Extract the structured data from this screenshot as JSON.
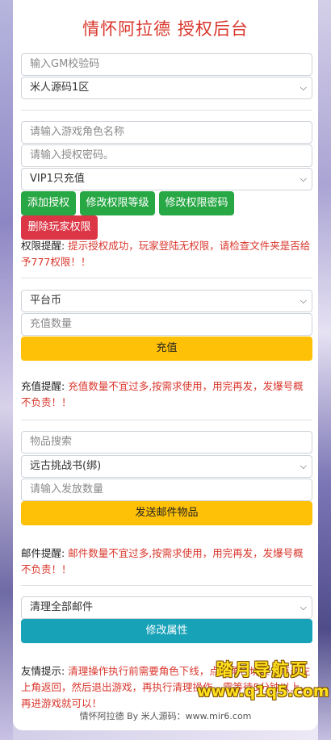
{
  "title": "情怀阿拉德 授权后台",
  "gm": {
    "code_placeholder": "输入GM校验码",
    "server_selected": "米人源码1区"
  },
  "auth": {
    "role_placeholder": "请输入游戏角色名称",
    "password_placeholder": "请输入授权密码。",
    "level_selected": "VIP1只充值",
    "add_label": "添加授权",
    "modify_level_label": "修改权限等级",
    "modify_password_label": "修改权限密码",
    "delete_label": "删除玩家权限",
    "notice_prefix": "权限提醒:",
    "notice_text": "提示授权成功，玩家登陆无权限，请检查文件夹是否给予777权限！！"
  },
  "recharge": {
    "currency_selected": "平台币",
    "amount_placeholder": "充值数量",
    "button_label": "充值",
    "notice_prefix": "充值提醒:",
    "notice_text": "充值数量不宜过多,按需求使用，用完再发，发爆号概不负责！！"
  },
  "mail": {
    "search_placeholder": "物品搜索",
    "item_selected": "远古挑战书(绑)",
    "quantity_placeholder": "请输入发放数量",
    "button_label": "发送邮件物品",
    "notice_prefix": "邮件提醒:",
    "notice_text": "邮件数量不宜过多,按需求使用，用完再发，发爆号概不负责！！"
  },
  "cleanup": {
    "action_selected": "清理全部邮件",
    "button_label": "修改属性",
    "notice_prefix": "友情提示:",
    "notice_text": "清理操作执行前需要角色下线，点击角色切换，点击左上角返回，然后退出游戏，再执行清理操作，需等待5分钟以上，再进游戏就可以！"
  },
  "footer": "情怀阿拉德 By 米人源码：www.mir6.com",
  "watermark": {
    "line1": "踏月导航页",
    "line2": "www.q1q5.com"
  }
}
